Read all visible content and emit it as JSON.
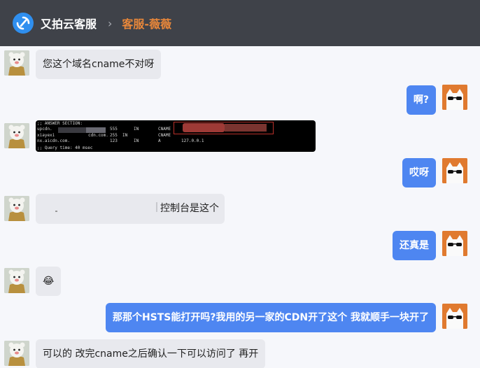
{
  "header": {
    "app_title": "又拍云客服",
    "separator": "›",
    "agent": "客服-薇薇"
  },
  "messages": [
    {
      "side": "in",
      "text": "您这个域名cname不对呀"
    },
    {
      "side": "out",
      "text": "啊?"
    },
    {
      "side": "in",
      "type": "image"
    },
    {
      "side": "out",
      "text": "哎呀"
    },
    {
      "side": "in",
      "text": "控制台是这个"
    },
    {
      "side": "out",
      "text": "还真是"
    },
    {
      "side": "in",
      "text": "😂"
    },
    {
      "side": "out",
      "text": "那那个HSTS能打开吗?我用的另一家的CDN开了这个 我就顺手一块开了"
    },
    {
      "side": "in",
      "text": "可以的 改完cname之后确认一下可以访问了 再开"
    }
  ],
  "terminal": {
    "lines": [
      ";; ANSWER SECTION:",
      "upcdn.",
      "xiayexi",
      "nx.aicdn.com.",
      ";; Query time: 40 msec"
    ],
    "col_ttl": [
      "555",
      "255",
      "123"
    ],
    "col_in": [
      "IN",
      "IN",
      "IN"
    ],
    "col_type": [
      "CNAME",
      "CNAME",
      "A"
    ],
    "tail": [
      "cdn.com.",
      "127.0.0.1"
    ]
  },
  "colors": {
    "header_bg": "#3f4249",
    "agent_orange": "#e8873a",
    "out_bubble": "#4e86f1",
    "in_bubble": "#e8e9ee",
    "logo_blue": "#2f8fef"
  }
}
